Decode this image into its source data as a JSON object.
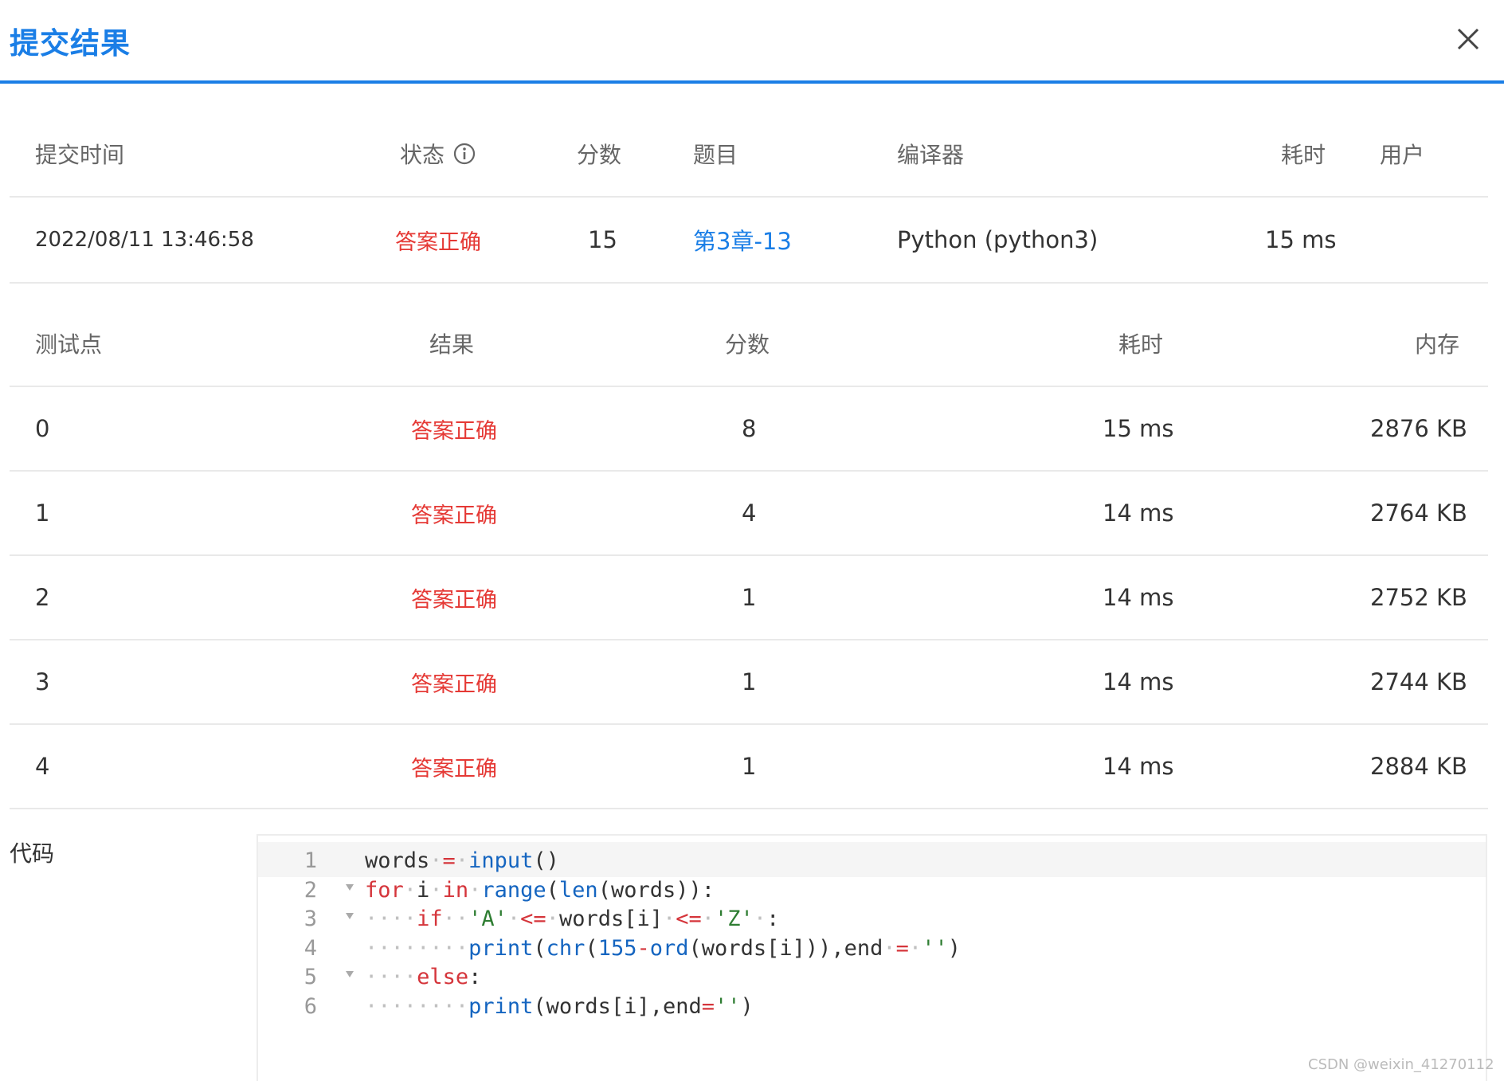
{
  "dialog": {
    "title": "提交结果"
  },
  "summary": {
    "headers": [
      "提交时间",
      "状态",
      "分数",
      "题目",
      "编译器",
      "耗时",
      "用户"
    ],
    "row": {
      "time": "2022/08/11 13:46:58",
      "status": "答案正确",
      "score": "15",
      "problem": "第3章-13",
      "compiler": "Python (python3)",
      "elapsed": "15 ms",
      "user": ""
    }
  },
  "tests": {
    "headers": [
      "测试点",
      "结果",
      "分数",
      "耗时",
      "内存"
    ],
    "rows": [
      {
        "id": "0",
        "result": "答案正确",
        "score": "8",
        "time": "15 ms",
        "memory": "2876 KB"
      },
      {
        "id": "1",
        "result": "答案正确",
        "score": "4",
        "time": "14 ms",
        "memory": "2764 KB"
      },
      {
        "id": "2",
        "result": "答案正确",
        "score": "1",
        "time": "14 ms",
        "memory": "2752 KB"
      },
      {
        "id": "3",
        "result": "答案正确",
        "score": "1",
        "time": "14 ms",
        "memory": "2744 KB"
      },
      {
        "id": "4",
        "result": "答案正确",
        "score": "1",
        "time": "14 ms",
        "memory": "2884 KB"
      }
    ]
  },
  "code": {
    "label": "代码",
    "lines": [
      "words = input()",
      "for i in range(len(words)):",
      "    if  'A' <= words[i] <= 'Z' :",
      "        print(chr(155-ord(words[i])),end = '')",
      "    else:",
      "        print(words[i],end='')"
    ]
  },
  "watermark": "CSDN @weixin_41270112",
  "colors": {
    "accent": "#1a7ee6",
    "status_ok": "#e53935"
  }
}
